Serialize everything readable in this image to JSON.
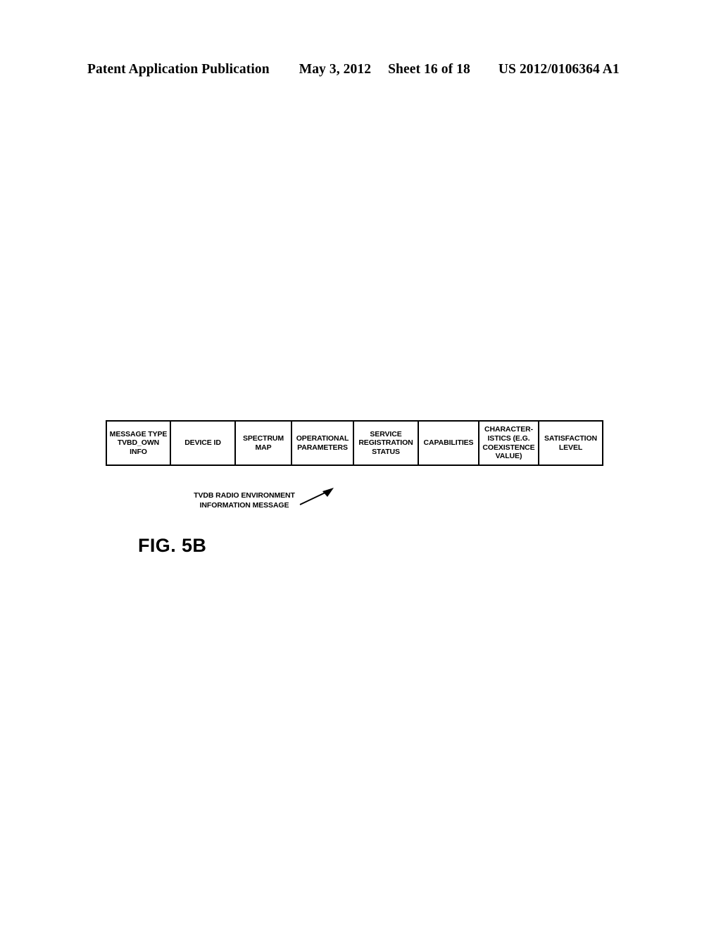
{
  "header": {
    "publication": "Patent Application Publication",
    "date": "May 3, 2012",
    "sheet": "Sheet 16 of 18",
    "document_number": "US 2012/0106364 A1"
  },
  "figure": {
    "label": "FIG. 5B",
    "callout_line1": "TVDB RADIO ENVIRONMENT",
    "callout_line2": "INFORMATION MESSAGE",
    "arrow_icon": "leader-arrow-icon"
  },
  "message_table": {
    "fields": [
      {
        "label": "MESSAGE TYPE TVBD_OWN INFO"
      },
      {
        "label": "DEVICE ID"
      },
      {
        "label": "SPECTRUM MAP"
      },
      {
        "label": "OPERATIONAL PARAMETERS"
      },
      {
        "label": "SERVICE REGISTRATION STATUS"
      },
      {
        "label": "CAPABILITIES"
      },
      {
        "label": "CHARACTER-ISTICS (E.G. COEXISTENCE VALUE)"
      },
      {
        "label": "SATISFACTION LEVEL"
      }
    ]
  },
  "colors": {
    "ink": "#000000",
    "paper": "#ffffff"
  }
}
